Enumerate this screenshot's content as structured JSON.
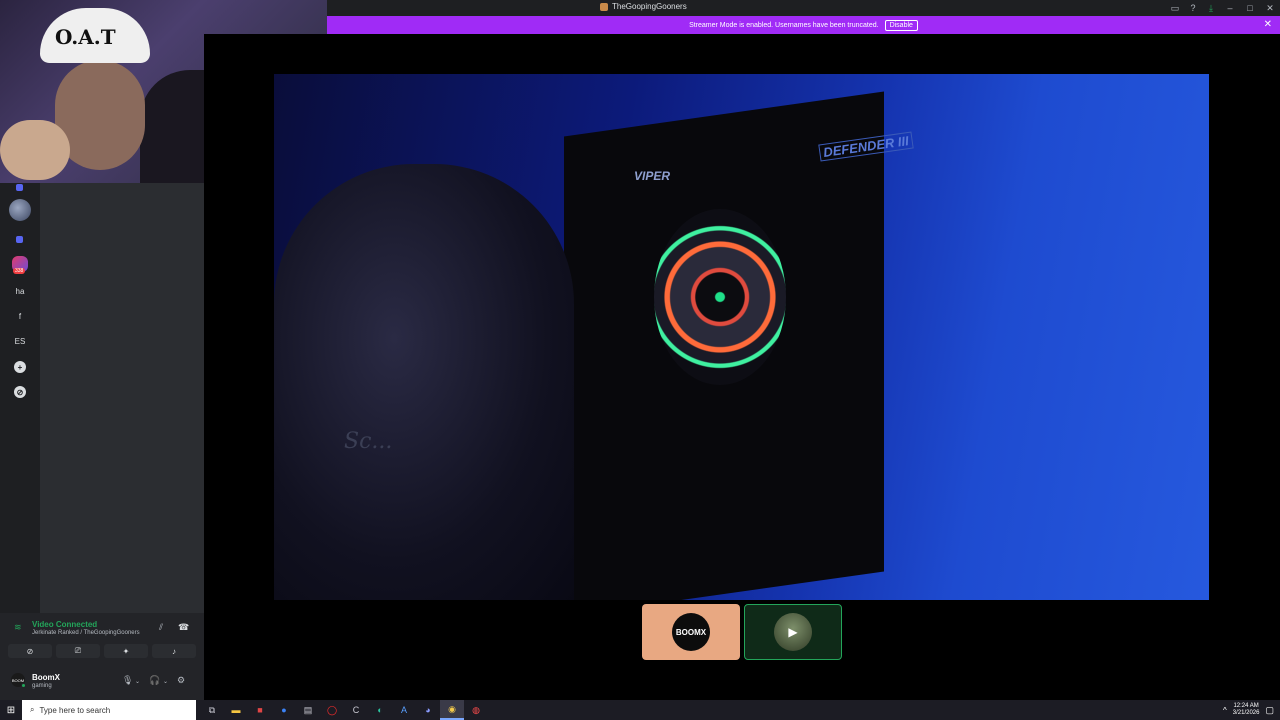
{
  "window": {
    "title": "TheGoopingGooners",
    "icons": [
      "inbox-icon",
      "help-icon",
      "download-icon"
    ],
    "window_buttons": [
      "minimize",
      "maximize",
      "close"
    ]
  },
  "banner": {
    "text": "Streamer Mode is enabled. Usernames have been truncated.",
    "disable_label": "Disable",
    "close_glyph": "✕"
  },
  "webcam": {
    "hat_text": "O.A.T"
  },
  "server_rail": {
    "items": [
      {
        "type": "dot"
      },
      {
        "type": "avatar"
      },
      {
        "type": "dot"
      },
      {
        "type": "mod",
        "badge": "338"
      },
      {
        "type": "text",
        "label": "ha"
      },
      {
        "type": "text",
        "label": "f"
      },
      {
        "type": "text",
        "label": "ES"
      },
      {
        "type": "add",
        "label": "+"
      },
      {
        "type": "discover",
        "label": "⊘"
      }
    ]
  },
  "voice": {
    "status": "Video Connected",
    "channel": "Jerkinate Ranked / TheGoopingGooners",
    "actions": [
      "camera-off",
      "screen-share",
      "activities",
      "soundboard"
    ]
  },
  "user": {
    "avatar_text": "BOOM",
    "name": "BoomX",
    "status": "gaming"
  },
  "video": {
    "board_brand": "VIPER",
    "board_model": "DEFENDER III",
    "shirt_text": "Sc..."
  },
  "participants": [
    {
      "name": "BOOMX",
      "type": "logo",
      "tile_color": "#e8a882"
    },
    {
      "name": "camera",
      "type": "camera",
      "tile_color": "#0f2a18",
      "speaking": true
    }
  ],
  "taskbar": {
    "search_placeholder": "Type here to search",
    "time": "12:24 AM",
    "date": "3/21/2026"
  },
  "colors": {
    "banner": "#a02bf6",
    "connected": "#23a55a"
  }
}
